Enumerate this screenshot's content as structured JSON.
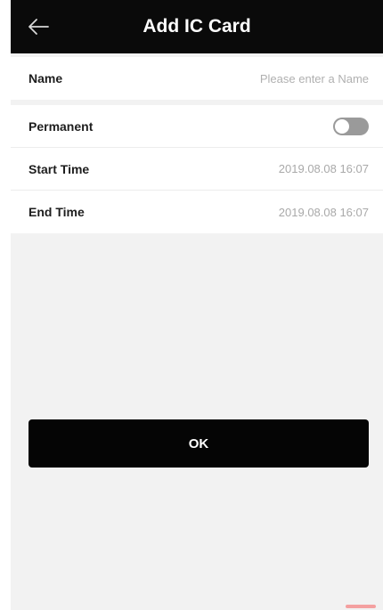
{
  "header": {
    "title": "Add IC Card",
    "back_icon": "arrow-left-icon"
  },
  "form": {
    "name": {
      "label": "Name",
      "value": "",
      "placeholder": "Please enter a Name"
    },
    "permanent": {
      "label": "Permanent",
      "enabled": false
    },
    "start_time": {
      "label": "Start Time",
      "value": "2019.08.08 16:07"
    },
    "end_time": {
      "label": "End Time",
      "value": "2019.08.08 16:07"
    }
  },
  "actions": {
    "ok_label": "OK"
  },
  "colors": {
    "header_bg": "#0a0a0a",
    "page_bg": "#f2f2f2",
    "button_bg": "#050505",
    "toggle_off": "#9a9a9a"
  }
}
